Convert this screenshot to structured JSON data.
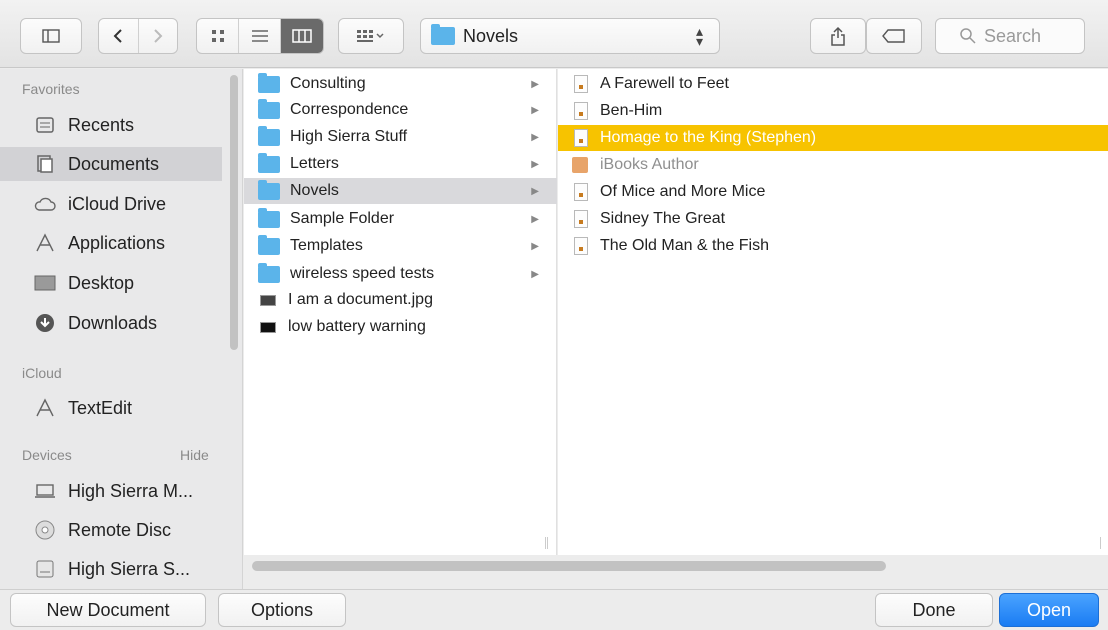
{
  "toolbar": {
    "path_label": "Novels",
    "search_placeholder": "Search"
  },
  "sidebar": {
    "favorites_header": "Favorites",
    "favorites": [
      {
        "label": "Recents",
        "icon": "recents-icon"
      },
      {
        "label": "Documents",
        "icon": "documents-icon",
        "selected": true
      },
      {
        "label": "iCloud Drive",
        "icon": "icloud-icon"
      },
      {
        "label": "Applications",
        "icon": "applications-icon"
      },
      {
        "label": "Desktop",
        "icon": "desktop-icon"
      },
      {
        "label": "Downloads",
        "icon": "downloads-icon"
      }
    ],
    "icloud_header": "iCloud",
    "icloud": [
      {
        "label": "TextEdit",
        "icon": "textedit-icon"
      }
    ],
    "devices_header": "Devices",
    "devices_hide": "Hide",
    "devices": [
      {
        "label": "High Sierra M...",
        "icon": "laptop-icon"
      },
      {
        "label": "Remote Disc",
        "icon": "disc-icon"
      },
      {
        "label": "High Sierra S...",
        "icon": "disk-icon"
      }
    ]
  },
  "column1": [
    {
      "label": "Consulting",
      "kind": "folder"
    },
    {
      "label": "Correspondence",
      "kind": "folder"
    },
    {
      "label": "High Sierra Stuff",
      "kind": "folder"
    },
    {
      "label": "Letters",
      "kind": "folder"
    },
    {
      "label": "Novels",
      "kind": "folder",
      "selected": true
    },
    {
      "label": "Sample Folder",
      "kind": "folder"
    },
    {
      "label": "Templates",
      "kind": "folder"
    },
    {
      "label": "wireless speed tests",
      "kind": "folder"
    },
    {
      "label": "I am a document.jpg",
      "kind": "image"
    },
    {
      "label": "low battery warning",
      "kind": "image"
    }
  ],
  "column2": [
    {
      "label": "A Farewell to Feet"
    },
    {
      "label": "Ben-Him"
    },
    {
      "label": "Homage to the King (Stephen)",
      "highlighted": true
    },
    {
      "label": "iBooks Author",
      "dimmed": true
    },
    {
      "label": "Of Mice and More Mice"
    },
    {
      "label": "Sidney The Great"
    },
    {
      "label": "The Old Man & the Fish"
    }
  ],
  "bottom": {
    "new_document": "New Document",
    "options": "Options",
    "done": "Done",
    "open": "Open"
  },
  "colors": {
    "highlight": "#f7c300",
    "folder": "#5bb4ea",
    "primary_button": "#1a7cf3"
  }
}
